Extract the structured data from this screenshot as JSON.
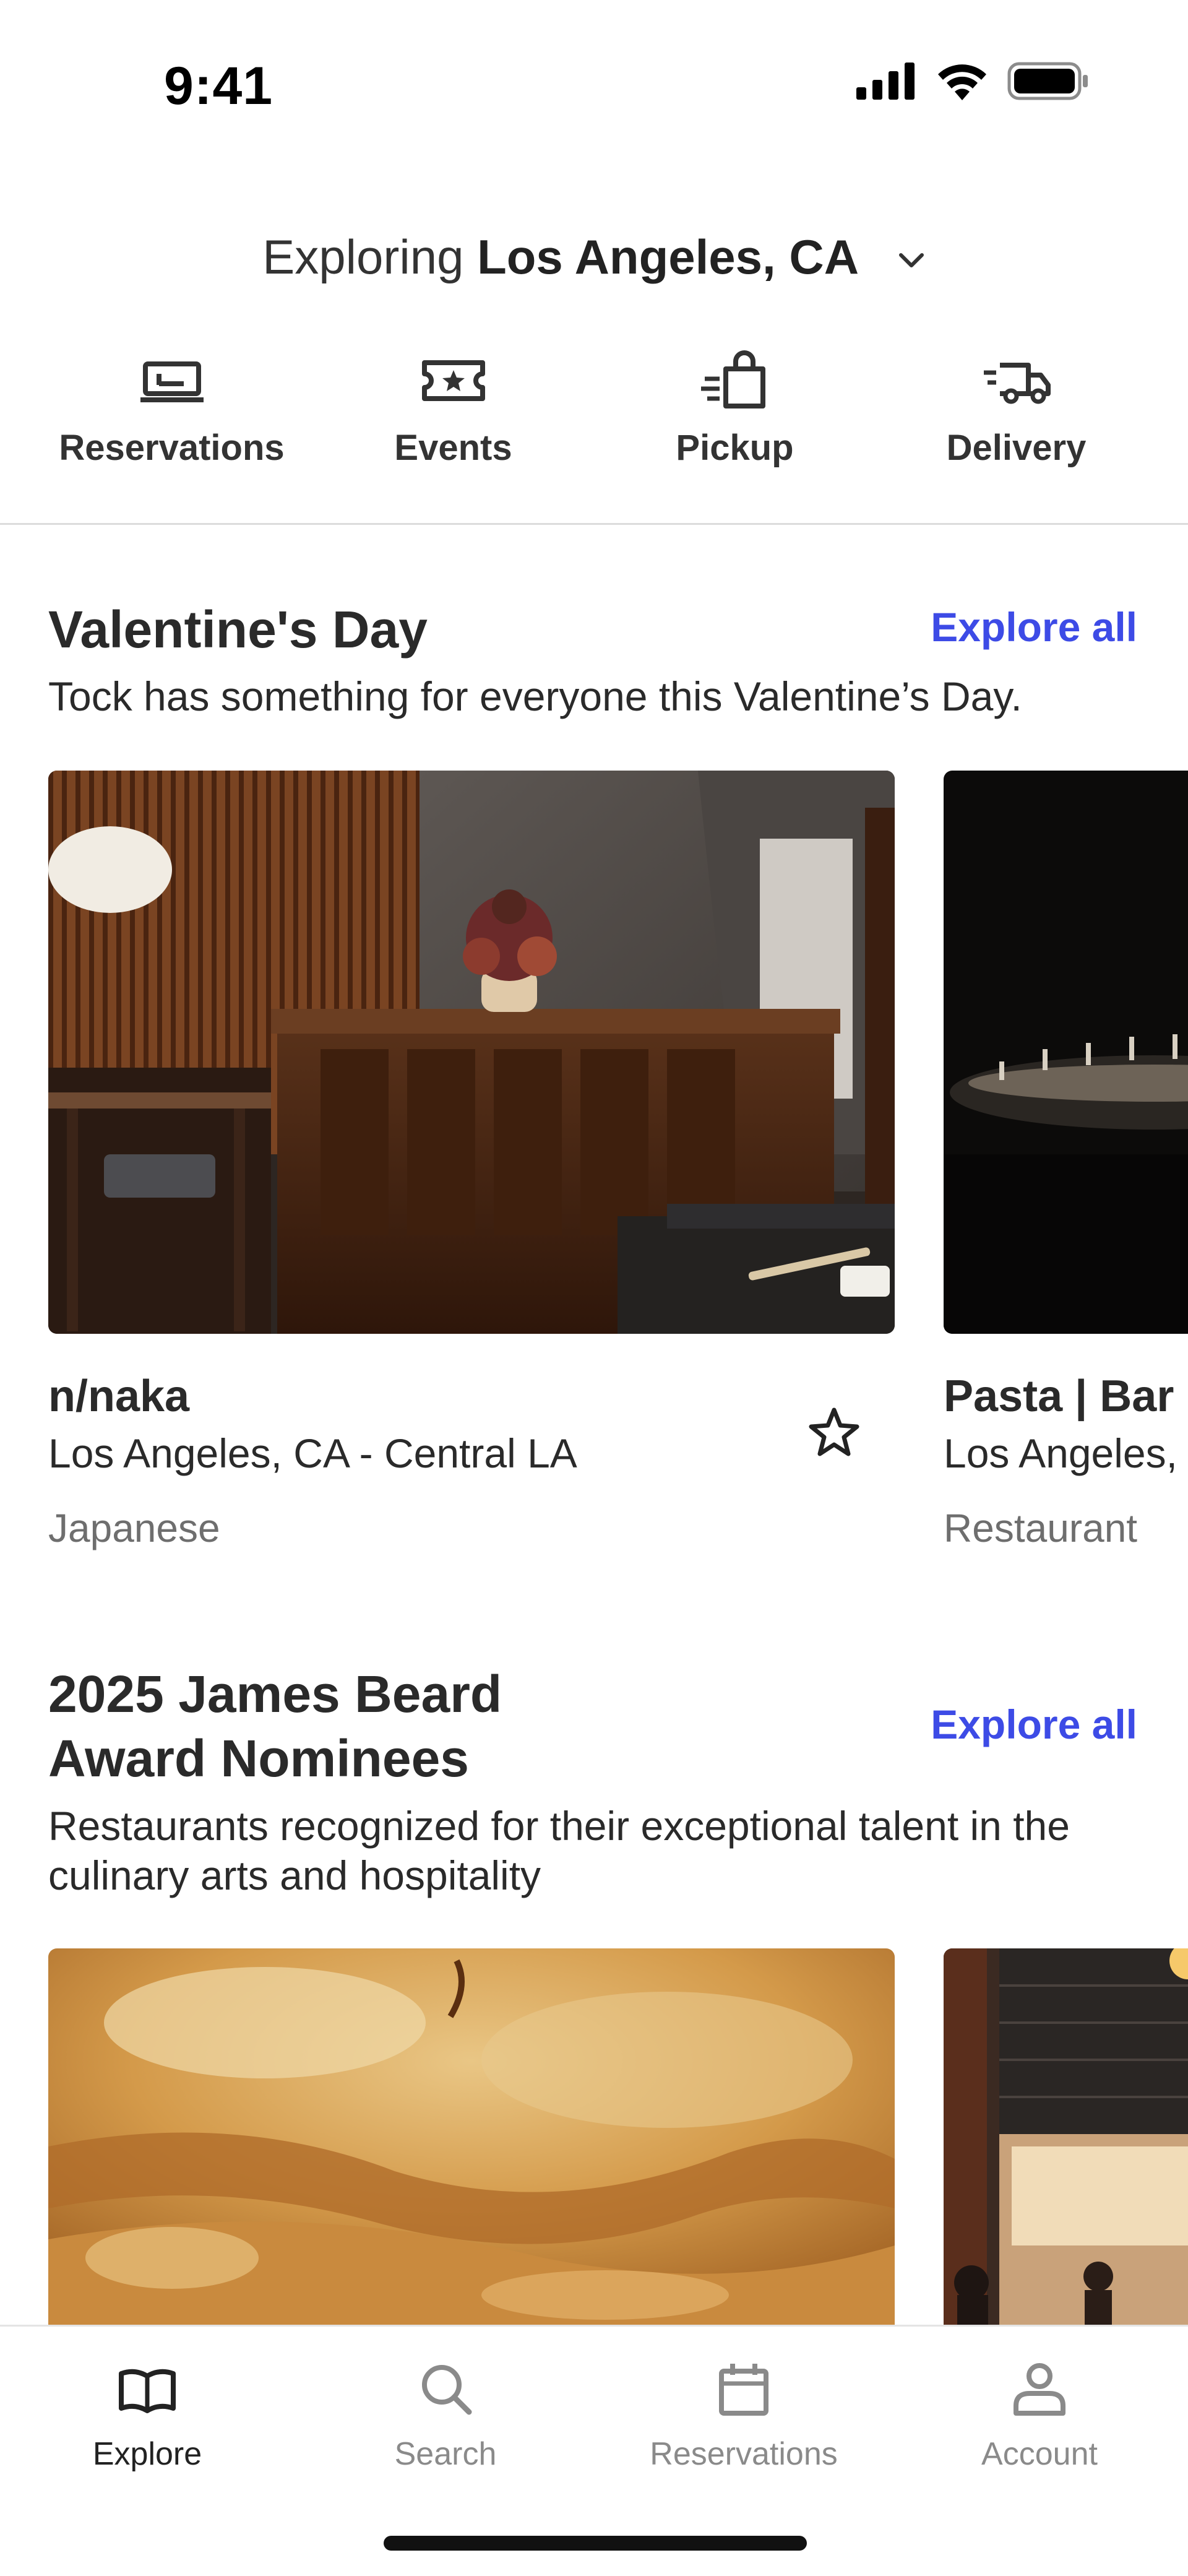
{
  "status_bar": {
    "time": "9:41"
  },
  "location": {
    "prefix": "Exploring",
    "city": "Los Angeles, CA"
  },
  "categories": [
    {
      "label": "Reservations",
      "icon": "reservation-icon"
    },
    {
      "label": "Events",
      "icon": "ticket-icon"
    },
    {
      "label": "Pickup",
      "icon": "bag-icon"
    },
    {
      "label": "Delivery",
      "icon": "delivery-truck-icon"
    }
  ],
  "sections": [
    {
      "title": "Valentine's Day",
      "explore_label": "Explore all",
      "subtitle": "Tock has something for everyone this Valentine’s Day.",
      "cards": [
        {
          "name": "n/naka",
          "location": "Los Angeles, CA - Central LA",
          "cuisine": "Japanese"
        },
        {
          "name": "Pasta | Bar",
          "location": "Los Angeles,",
          "cuisine": "Restaurant"
        }
      ]
    },
    {
      "title_line1": "2025 James Beard",
      "title_line2": "Award Nominees",
      "explore_label": "Explore all",
      "subtitle": "Restaurants recognized for their exceptional talent in the culinary arts and hospitality"
    }
  ],
  "bottom_nav": [
    {
      "label": "Explore",
      "icon": "book-icon",
      "active": true
    },
    {
      "label": "Search",
      "icon": "search-icon",
      "active": false
    },
    {
      "label": "Reservations",
      "icon": "calendar-icon",
      "active": false
    },
    {
      "label": "Account",
      "icon": "person-icon",
      "active": false
    }
  ],
  "colors": {
    "accent": "#3d4be6",
    "text": "#2a2a2a",
    "muted": "#6e6e6e"
  }
}
